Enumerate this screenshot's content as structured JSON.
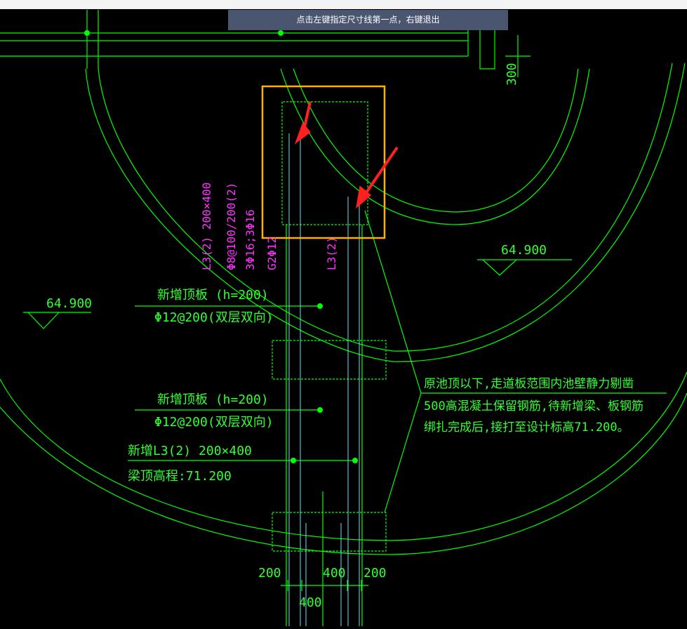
{
  "command_prompt": "点击左键指定尺寸线第一点，右键退出",
  "elevations": [
    "64.900",
    "64.900"
  ],
  "beam_label_left": [
    "L3(2) 200×400",
    "Φ8@100/200(2)",
    "3Φ16;3Φ16",
    "G2Φ12"
  ],
  "beam_label_right": "L3(2)",
  "slab_note_1": {
    "title": "新增顶板 (h=200)",
    "rebar": "Φ12@200(双层双向)"
  },
  "slab_note_2": {
    "title": "新增顶板 (h=200)",
    "rebar": "Φ12@200(双层双向)"
  },
  "beam_note": {
    "title": "新增L3(2) 200×400",
    "elevation": "梁顶高程:71.200"
  },
  "wall_note": [
    "原池顶以下,走道板范围内池壁静力剔凿",
    "500高混凝土保留钢筋,待新增梁、板钢筋",
    "绑扎完成后,接打至设计标高71.200。"
  ],
  "dimensions": {
    "top_right": "300",
    "bottom": [
      "200",
      "400",
      "200"
    ],
    "bottom_total": "400"
  },
  "colors": {
    "background": "#000000",
    "lines": "#00ff00",
    "text": "#33ff33",
    "beam_label": "#ff33ff",
    "cyan": "#66e0ff",
    "highlight": "#ffb000",
    "arrow": "#ff2020",
    "prompt_bg": "#4a5570"
  }
}
